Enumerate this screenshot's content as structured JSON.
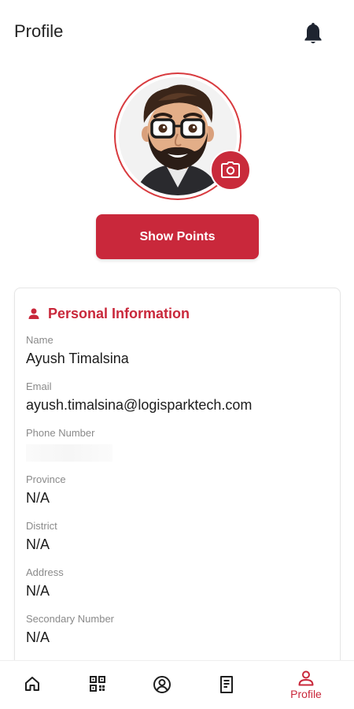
{
  "header": {
    "title": "Profile",
    "notification_icon": "bell-icon"
  },
  "avatar": {
    "edit_icon": "camera-icon",
    "border_color": "#d83b3f"
  },
  "actions": {
    "show_points_label": "Show Points",
    "accent_color": "#c9283b"
  },
  "personal_information": {
    "title": "Personal Information",
    "icon": "person-icon",
    "fields": [
      {
        "label": "Name",
        "value": "Ayush Timalsina"
      },
      {
        "label": "Email",
        "value": "ayush.timalsina@logisparktech.com"
      },
      {
        "label": "Phone Number",
        "value": ""
      },
      {
        "label": "Province",
        "value": "N/A"
      },
      {
        "label": "District",
        "value": "N/A"
      },
      {
        "label": "Address",
        "value": "N/A"
      },
      {
        "label": "Secondary Number",
        "value": "N/A"
      }
    ]
  },
  "bottom_nav": {
    "items": [
      {
        "icon": "home-icon",
        "label": ""
      },
      {
        "icon": "qr-code-icon",
        "label": ""
      },
      {
        "icon": "profile-circle-icon",
        "label": ""
      },
      {
        "icon": "document-icon",
        "label": ""
      },
      {
        "icon": "person-outline-icon",
        "label": "Profile"
      }
    ],
    "active_index": 4
  }
}
